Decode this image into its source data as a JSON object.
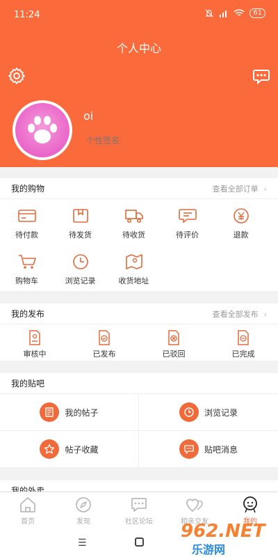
{
  "status_bar": {
    "time": "11:24",
    "battery": "61"
  },
  "header": {
    "title": "个人中心",
    "username": "oi",
    "signature": "个性签名"
  },
  "shopping": {
    "title": "我的购物",
    "more": "查看全部订单",
    "items": [
      {
        "label": "待付款",
        "icon": "wallet-card-icon"
      },
      {
        "label": "待发货",
        "icon": "package-box-icon"
      },
      {
        "label": "待收货",
        "icon": "delivery-truck-icon"
      },
      {
        "label": "待评价",
        "icon": "comment-bubble-icon"
      },
      {
        "label": "退款",
        "icon": "yen-refund-icon"
      },
      {
        "label": "购物车",
        "icon": "shopping-cart-icon"
      },
      {
        "label": "浏览记录",
        "icon": "clock-history-icon"
      },
      {
        "label": "收货地址",
        "icon": "map-location-icon"
      }
    ]
  },
  "publish": {
    "title": "我的发布",
    "more": "查看全部发布",
    "items": [
      {
        "label": "审核中",
        "icon": "document-review-icon"
      },
      {
        "label": "已发布",
        "icon": "document-check-icon"
      },
      {
        "label": "已驳回",
        "icon": "document-rejected-icon"
      },
      {
        "label": "已完成",
        "icon": "document-done-icon"
      }
    ]
  },
  "forum": {
    "title": "我的贴吧",
    "items": [
      {
        "label": "我的帖子",
        "icon": "post-list-icon"
      },
      {
        "label": "浏览记录",
        "icon": "clock-icon"
      },
      {
        "label": "帖子收藏",
        "icon": "star-icon"
      },
      {
        "label": "贴吧消息",
        "icon": "message-icon"
      }
    ]
  },
  "next_section": {
    "title": "我的外卖"
  },
  "tabbar": [
    {
      "label": "首页",
      "icon": "home-icon"
    },
    {
      "label": "发现",
      "icon": "compass-icon"
    },
    {
      "label": "社区论坛",
      "icon": "chat-dots-icon"
    },
    {
      "label": "相亲交友",
      "icon": "hearts-icon"
    },
    {
      "label": "我的",
      "icon": "profile-face-icon"
    }
  ],
  "watermark": {
    "number": "962.NET",
    "site": "乐游网"
  },
  "colors": {
    "accent": "#fb6a3a",
    "icon": "#e36a3a"
  }
}
